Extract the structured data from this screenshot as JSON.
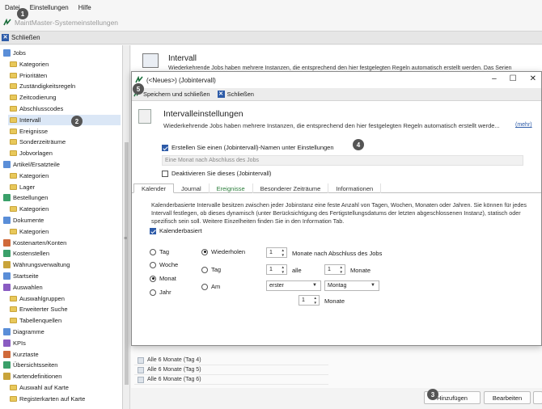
{
  "menu": {
    "items": [
      "Datei",
      "Einstellungen",
      "Hilfe"
    ]
  },
  "window": {
    "title": "MaintMaster-Systemeinstellungen"
  },
  "toolbar": {
    "close_label": "Schließen"
  },
  "sidebar": {
    "items": [
      {
        "label": "Jobs",
        "level": 0,
        "selected": false
      },
      {
        "label": "Kategorien",
        "level": 1,
        "selected": false
      },
      {
        "label": "Prioritäten",
        "level": 1,
        "selected": false
      },
      {
        "label": "Zuständigkeitsregeln",
        "level": 1,
        "selected": false
      },
      {
        "label": "Zeitcodierung",
        "level": 1,
        "selected": false
      },
      {
        "label": "Abschlusscodes",
        "level": 1,
        "selected": false
      },
      {
        "label": "Intervall",
        "level": 1,
        "selected": true
      },
      {
        "label": "Ereignisse",
        "level": 1,
        "selected": false
      },
      {
        "label": "Sonderzeiträume",
        "level": 1,
        "selected": false
      },
      {
        "label": "Jobvorlagen",
        "level": 1,
        "selected": false
      },
      {
        "label": "Artikel/Ersatzteile",
        "level": 0,
        "selected": false
      },
      {
        "label": "Kategorien",
        "level": 1,
        "selected": false
      },
      {
        "label": "Lager",
        "level": 1,
        "selected": false
      },
      {
        "label": "Bestellungen",
        "level": 0,
        "selected": false
      },
      {
        "label": "Kategorien",
        "level": 1,
        "selected": false
      },
      {
        "label": "Dokumente",
        "level": 0,
        "selected": false
      },
      {
        "label": "Kategorien",
        "level": 1,
        "selected": false
      },
      {
        "label": "Kostenarten/Konten",
        "level": 0,
        "selected": false
      },
      {
        "label": "Kostenstellen",
        "level": 0,
        "selected": false
      },
      {
        "label": "Währungsverwaltung",
        "level": 0,
        "selected": false
      },
      {
        "label": "Startseite",
        "level": 0,
        "selected": false
      },
      {
        "label": "Auswahlen",
        "level": 0,
        "selected": false
      },
      {
        "label": "Auswahlgruppen",
        "level": 1,
        "selected": false
      },
      {
        "label": "Erweiterter Suche",
        "level": 1,
        "selected": false
      },
      {
        "label": "Tabellenquellen",
        "level": 1,
        "selected": false
      },
      {
        "label": "Diagramme",
        "level": 0,
        "selected": false
      },
      {
        "label": "KPIs",
        "level": 0,
        "selected": false
      },
      {
        "label": "Kurztaste",
        "level": 0,
        "selected": false
      },
      {
        "label": "Übersichtsseiten",
        "level": 0,
        "selected": false
      },
      {
        "label": "Kartendefinitionen",
        "level": 0,
        "selected": false
      },
      {
        "label": "Auswahl auf Karte",
        "level": 1,
        "selected": false
      },
      {
        "label": "Registerkarten auf Karte",
        "level": 1,
        "selected": false
      }
    ]
  },
  "main": {
    "title": "Intervall",
    "description": "Wiederkehrende Jobs haben mehrere Instanzen, die entsprechend den hier festgelegten Regeln automatisch erstellt werden. Das Serien",
    "list_rows": [
      "Alle 6 Monate (Tag 4)",
      "Alle 6 Monate (Tag 5)",
      "Alle 6 Monate (Tag 6)"
    ],
    "add_button": "Hinzufügen",
    "edit_button": "Bearbeiten"
  },
  "dialog": {
    "title": "(<Neues>) (Jobintervall)",
    "save_close": "Speichern und schließen",
    "close": "Schließen",
    "heading": "Intervalleinstellungen",
    "description": "Wiederkehrende Jobs haben mehrere Instanzen, die entsprechend den hier festgelegten Regeln automatisch erstellt werde...",
    "more_link": "(mehr)",
    "create_name_label": "Erstellen Sie einen (Jobintervall)-Namen unter Einstellungen",
    "name_field_value": "Eine Monat nach Abschluss des Jobs",
    "deactivate_label": "Deaktivieren Sie dieses (Jobintervall)",
    "tabs": [
      "Kalender",
      "Journal",
      "Ereignisse",
      "Besonderer Zeiträume",
      "Informationen"
    ],
    "info_text": "Kalenderbasierte Intervalle besitzen zwischen jeder Jobinstanz eine feste Anzahl von Tagen, Wochen, Monaten oder Jahren. Sie können für jedes Intervall festlegen, ob dieses dynamisch (unter Berücksichtigung des Fertigstellungsdatums der letzten abgeschlossenen Instanz), statisch oder spezifisch sein soll. Weitere Einzelheiten finden Sie in den Information Tab.",
    "calendar_based_label": "Kalenderbasiert",
    "period_options": [
      "Tag",
      "Woche",
      "Monat",
      "Jahr"
    ],
    "selected_period": "Monat",
    "repeat_options": [
      "Wiederholen",
      "Tag",
      "Am"
    ],
    "selected_repeat": "Wiederholen",
    "repeat_value": "1",
    "repeat_suffix": "Monate nach Abschluss des Jobs",
    "day_value": "1",
    "every_label": "alle",
    "every_value": "1",
    "every_suffix": "Monate",
    "am_ordinal": "erster",
    "am_weekday": "Montag",
    "am_months_value": "1",
    "am_months_suffix": "Monate"
  },
  "badges": [
    "1",
    "2",
    "3",
    "4",
    "5"
  ],
  "colors": {
    "accent": "#2d5ba8",
    "selection": "#dbe7f6",
    "folder": "#e8c85a"
  }
}
